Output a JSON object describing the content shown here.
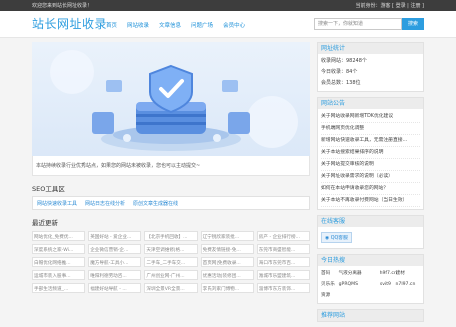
{
  "topbar": {
    "welcome": "欢迎您来到站长网址收录！",
    "user_links": "当前身份：游客 [ 登录 | 注册 ]"
  },
  "header": {
    "logo": "站长网址收录",
    "nav": [
      "首页",
      "网站收录",
      "文章信息",
      "问题广场",
      "会员中心"
    ],
    "search_placeholder": "搜索一下，你就知道",
    "search_button": "搜索"
  },
  "banner": {
    "caption": "本站持续收录行业优秀站点，如果您的网站未被收录，您也可以主动提交~"
  },
  "seo_tools": {
    "title": "SEO工具区",
    "items": [
      "网站快速收录工具",
      "网站日志在线分析",
      "原创文章生成器在线"
    ]
  },
  "recent": {
    "title": "最近更新",
    "items": [
      "网站优化_免费优...",
      "英国好站 - 爱企业...",
      "【北京手机回收】...",
      "辽宁锐欣家装批...",
      "房产 - 企业排行榜...",
      "深度系统之家-Wi...",
      "企业微信营销-企...",
      "天津空调维修|格...",
      "免费友情链接-免...",
      "东莞市商盛智能...",
      "白帽优化网络推...",
      "魔方导航-工具小...",
      "二手车_二手车交...",
      "首页网|免费收录...",
      "海口市东莞市百...",
      "运城市装入股事...",
      "唯阳利德劳动咨...",
      "广州创业网-广州...",
      "优惠活动|装修团...",
      "潍城市乐盟建筑...",
      "手部生活频道_...",
      "福建好站导航 - ...",
      "深圳全景VR全景...",
      "李氏刘家门博物...",
      "淄博市东方装饰..."
    ]
  },
  "stats": {
    "title": "网址统计",
    "items": [
      "收录网站：98248个",
      "今日收录：84个",
      "会员总数：138位"
    ]
  },
  "notice": {
    "title": "网站公告",
    "items": [
      "关于网站收录网新增TDK优化建议",
      "手机端网页优化调整",
      "新增网站快速收录工具，无需注册直接...",
      "关于本站搜索结果排序的说明",
      "关于网站提交审核的说明",
      "关于网址收录需求的说明（必读）",
      "如何在本站申请收录您的网站？",
      "关于本站不再收录付费网站（当日生效）"
    ]
  },
  "support": {
    "title": "在线客服",
    "qq_label": "QQ客服"
  },
  "hot": {
    "title": "今日热搜",
    "rows": [
      [
        "首码",
        "气液分离器",
        "h9f7.cn",
        "建材"
      ],
      [
        "贝乐乐",
        "gPRQMS",
        "svit9",
        "n7l97.cn"
      ],
      [
        "资源",
        "",
        "",
        ""
      ]
    ]
  },
  "recommend": {
    "title": "推荐网站"
  }
}
